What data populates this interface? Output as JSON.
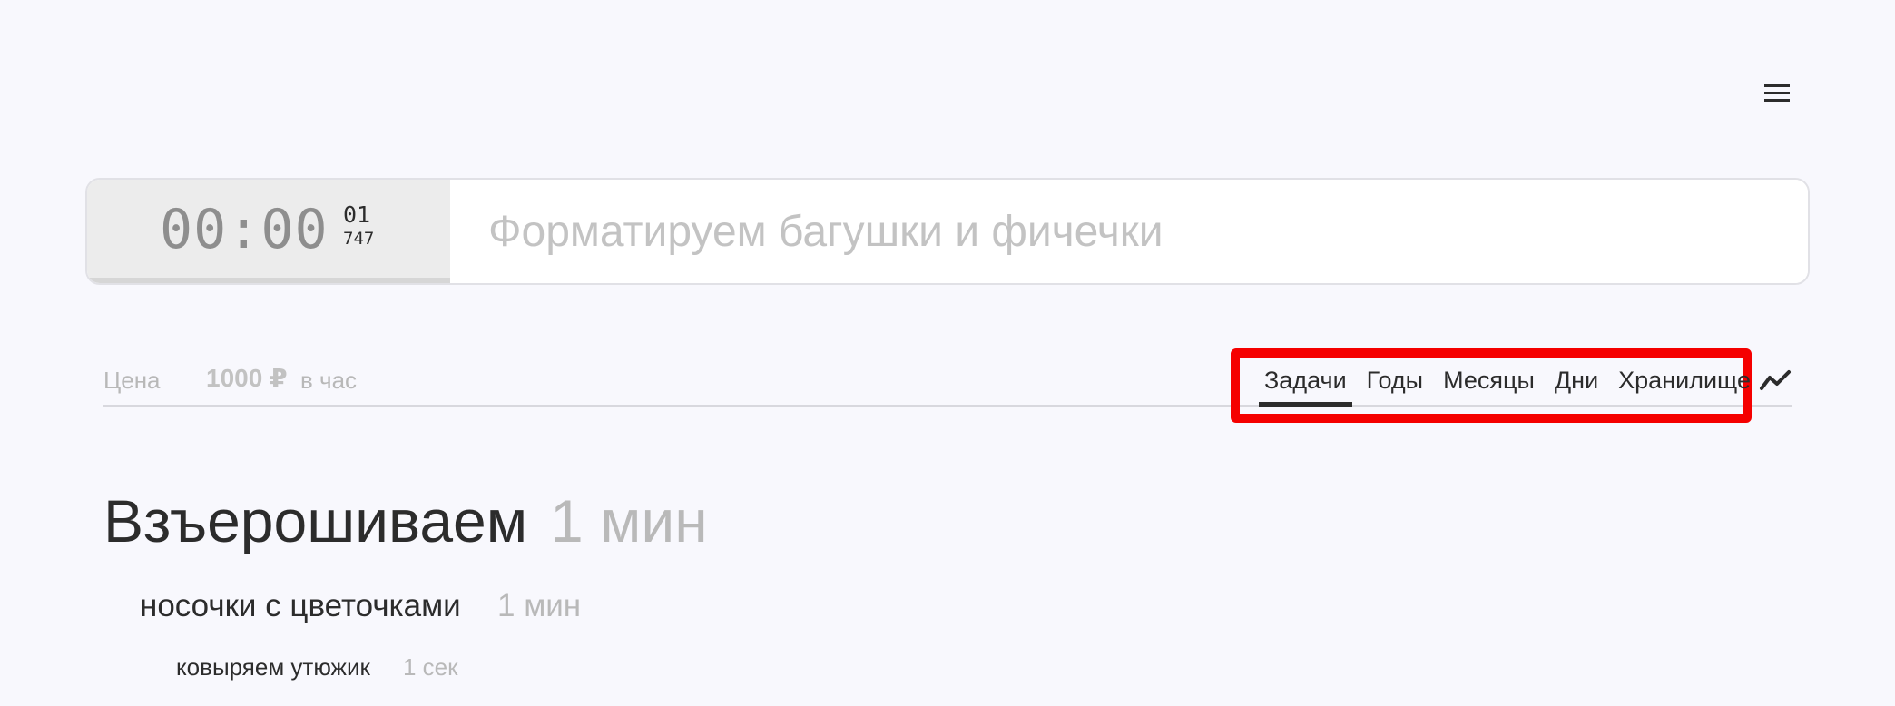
{
  "menu": {
    "icon": "hamburger-menu-icon"
  },
  "timer": {
    "display": "00:00",
    "sub_top": "01",
    "sub_bottom": "747"
  },
  "task_input": {
    "value": "",
    "placeholder": "Форматируем багушки и фичечки"
  },
  "price": {
    "label": "Цена",
    "value": "1000 ₽",
    "unit": "в час"
  },
  "tabs": [
    {
      "label": "Задачи",
      "active": true
    },
    {
      "label": "Годы",
      "active": false
    },
    {
      "label": "Месяцы",
      "active": false
    },
    {
      "label": "Дни",
      "active": false
    },
    {
      "label": "Хранилище",
      "active": false
    }
  ],
  "stats": {
    "icon": "trend-chart-icon"
  },
  "highlight_color": "#f50000",
  "tasks": {
    "group": {
      "title": "Взъерошиваем",
      "time": "1 мин"
    },
    "subgroup": {
      "title": "носочки с цветочками",
      "time": "1 мин"
    },
    "item": {
      "title": "ковыряем утюжик",
      "time": "1 сек"
    }
  }
}
